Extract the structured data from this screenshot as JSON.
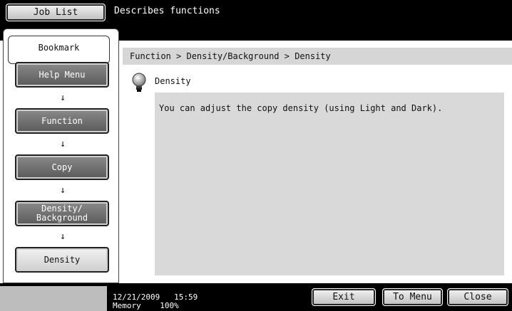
{
  "header": {
    "job_list_label": "Job List",
    "description": "Describes functions"
  },
  "sidebar": {
    "bookmark_label": "Bookmark",
    "items": [
      {
        "label": "Help Menu"
      },
      {
        "label": "Function"
      },
      {
        "label": "Copy"
      },
      {
        "label_line1": "Density/",
        "label_line2": "Background"
      },
      {
        "label": "Density"
      }
    ],
    "arrow_glyph": "↓"
  },
  "main": {
    "breadcrumb": "Function > Density/Background > Density",
    "topic_title": "Density",
    "content": "You can adjust the copy density (using Light and Dark)."
  },
  "footer": {
    "date": "12/21/2009",
    "time": "15:59",
    "memory_label": "Memory",
    "memory_value": "100%",
    "exit_label": "Exit",
    "to_menu_label": "To Menu",
    "close_label": "Close"
  },
  "icons": {
    "topic_icon": "lightbulb-icon"
  }
}
